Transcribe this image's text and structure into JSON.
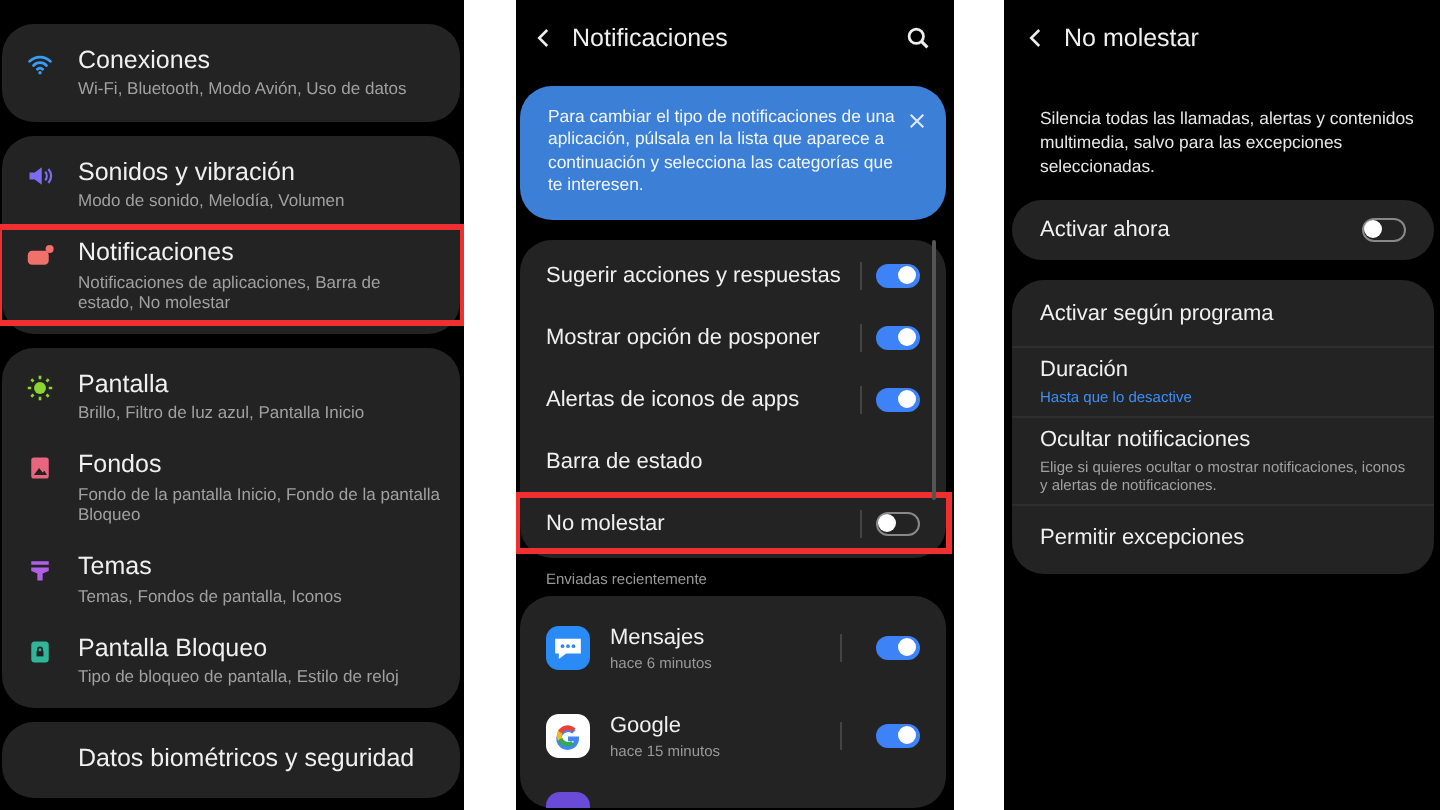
{
  "settings_screen": {
    "groups": [
      {
        "items": [
          {
            "title": "Conexiones",
            "subtitle": "Wi-Fi, Bluetooth, Modo Avión, Uso de datos",
            "color": "#3a9df5",
            "highlighted": false
          }
        ]
      },
      {
        "items": [
          {
            "title": "Sonidos y vibración",
            "subtitle": "Modo de sonido, Melodía, Volumen",
            "color": "#7b6cf0",
            "highlighted": false
          },
          {
            "title": "Notificaciones",
            "subtitle": "Notificaciones de aplicaciones, Barra de estado, No molestar",
            "color": "#f0706a",
            "highlighted": true
          }
        ]
      },
      {
        "items": [
          {
            "title": "Pantalla",
            "subtitle": "Brillo, Filtro de luz azul, Pantalla Inicio",
            "color": "#8bd630",
            "highlighted": false
          },
          {
            "title": "Fondos",
            "subtitle": "Fondo de la pantalla Inicio, Fondo de la pantalla Bloqueo",
            "color": "#e8657e",
            "highlighted": false
          },
          {
            "title": "Temas",
            "subtitle": "Temas, Fondos de pantalla, Iconos",
            "color": "#b060e8",
            "highlighted": false
          },
          {
            "title": "Pantalla Bloqueo",
            "subtitle": "Tipo de bloqueo de pantalla, Estilo de reloj",
            "color": "#2fb59a",
            "highlighted": false
          }
        ]
      },
      {
        "items": [
          {
            "title": "Datos biométricos y seguridad",
            "highlighted": false
          }
        ]
      }
    ]
  },
  "notifications_screen": {
    "title": "Notificaciones",
    "info_card": "Para cambiar el tipo de notificaciones de una aplicación, púlsala en la lista que aparece a continuación y selecciona las categorías que te interesen.",
    "options": [
      {
        "label": "Sugerir acciones y respuestas",
        "kind": "toggle",
        "on": true,
        "highlighted": false
      },
      {
        "label": "Mostrar opción de posponer",
        "kind": "toggle",
        "on": true,
        "highlighted": false
      },
      {
        "label": "Alertas de iconos de apps",
        "kind": "toggle",
        "on": true,
        "highlighted": false
      },
      {
        "label": "Barra de estado",
        "kind": "link",
        "highlighted": false
      },
      {
        "label": "No molestar",
        "kind": "toggle",
        "on": false,
        "highlighted": true
      }
    ],
    "recent_label": "Enviadas recientemente",
    "apps": [
      {
        "name": "Mensajes",
        "time": "hace 6 minutos",
        "on": true
      },
      {
        "name": "Google",
        "time": "hace 15 minutos",
        "on": true
      }
    ]
  },
  "dnd_screen": {
    "title": "No molestar",
    "description": "Silencia todas las llamadas, alertas y contenidos multimedia, salvo para las excepciones seleccionadas.",
    "activate_now": {
      "label": "Activar ahora",
      "on": false
    },
    "items": [
      {
        "title": "Activar según programa"
      },
      {
        "title": "Duración",
        "value": "Hasta que lo desactive"
      },
      {
        "title": "Ocultar notificaciones",
        "subtitle": "Elige si quieres ocultar o mostrar notificaciones, iconos y alertas de notificaciones."
      },
      {
        "title": "Permitir excepciones"
      }
    ]
  }
}
